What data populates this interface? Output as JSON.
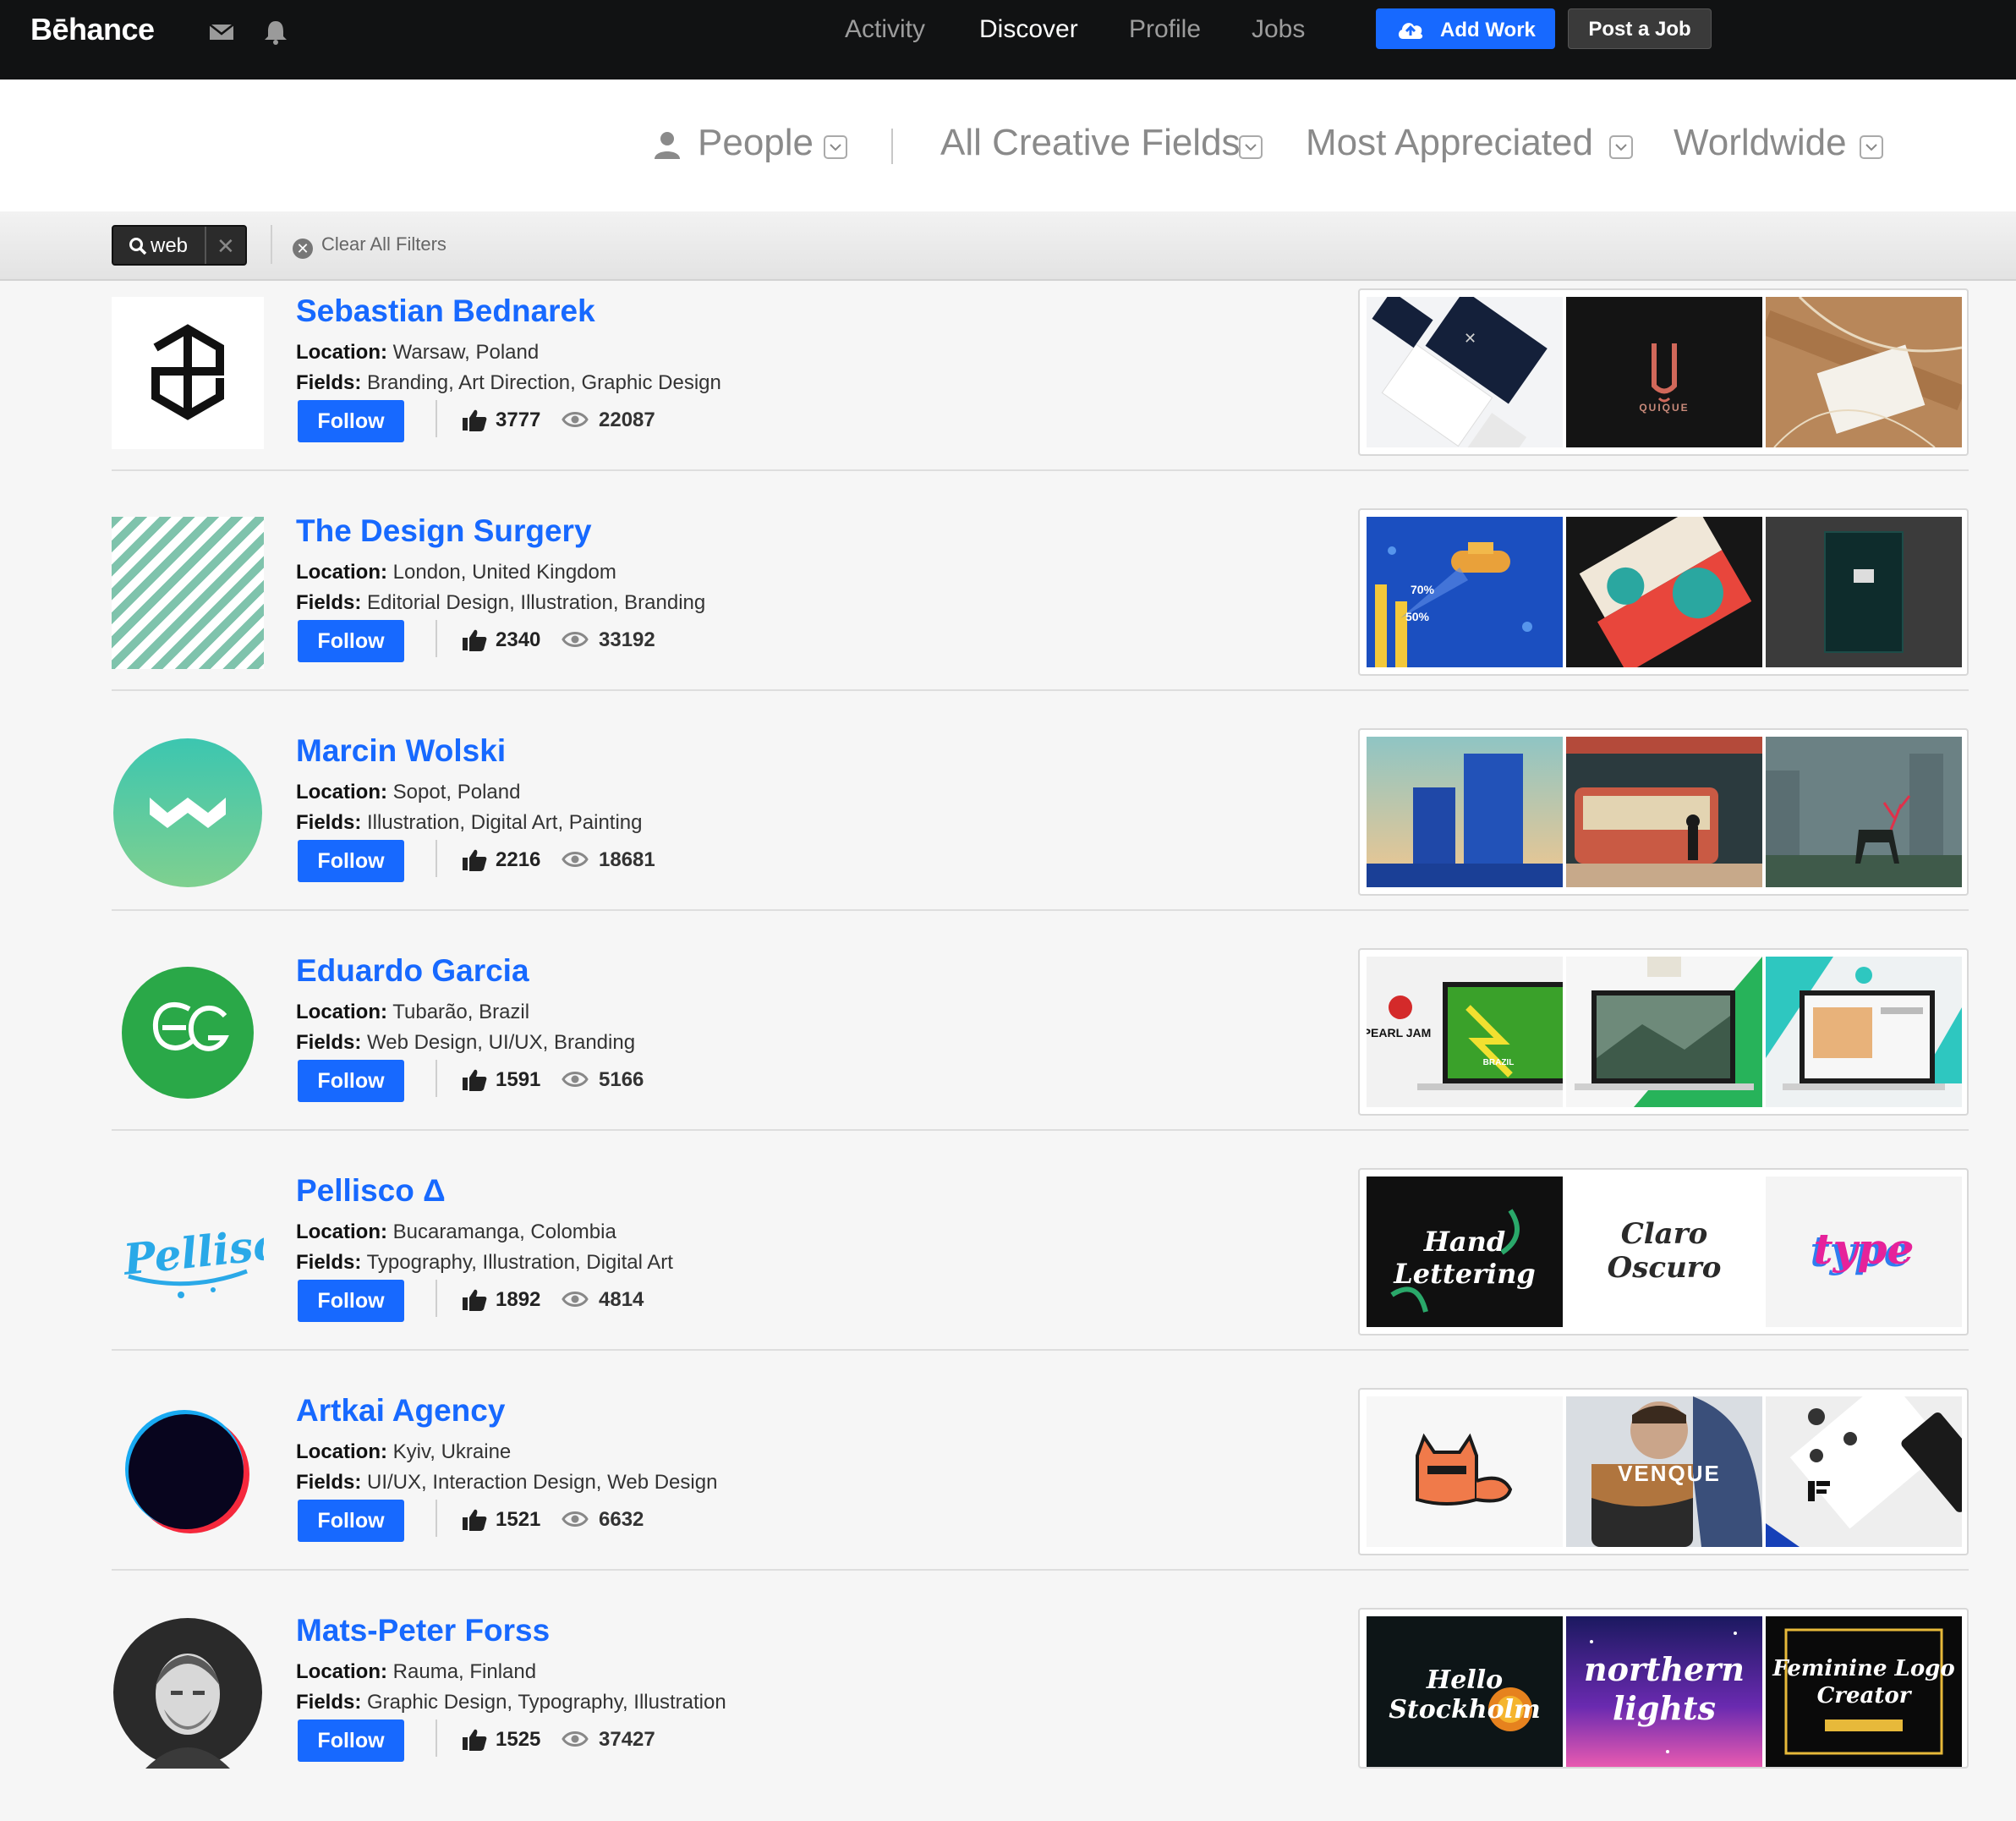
{
  "nav": {
    "logo": "Bēhance",
    "links": [
      "Activity",
      "Discover",
      "Profile",
      "Jobs"
    ],
    "active_link": "Discover",
    "add_work": "Add Work",
    "post_job": "Post a Job"
  },
  "filters": {
    "type": "People",
    "creative_fields": "All Creative Fields",
    "sort": "Most Appreciated",
    "location": "Worldwide"
  },
  "search": {
    "query": "web",
    "clear_all": "Clear All Filters"
  },
  "labels": {
    "location": "Location:",
    "fields": "Fields:",
    "follow": "Follow"
  },
  "colors": {
    "accent": "#1769ff",
    "topbar": "#111213"
  },
  "results": [
    {
      "name": "Sebastian Bednarek",
      "location": "Warsaw, Poland",
      "fields": "Branding, Art Direction, Graphic Design",
      "appreciations": "3777",
      "views": "22087"
    },
    {
      "name": "The Design Surgery",
      "location": "London, United Kingdom",
      "fields": "Editorial Design, Illustration, Branding",
      "appreciations": "2340",
      "views": "33192"
    },
    {
      "name": "Marcin Wolski",
      "location": "Sopot, Poland",
      "fields": "Illustration, Digital Art, Painting",
      "appreciations": "2216",
      "views": "18681"
    },
    {
      "name": "Eduardo Garcia",
      "location": "Tubarão, Brazil",
      "fields": "Web Design, UI/UX, Branding",
      "appreciations": "1591",
      "views": "5166"
    },
    {
      "name": "Pellisco Δ",
      "location": "Bucaramanga, Colombia",
      "fields": "Typography, Illustration, Digital Art",
      "appreciations": "1892",
      "views": "4814"
    },
    {
      "name": "Artkai Agency",
      "location": "Kyiv, Ukraine",
      "fields": "UI/UX, Interaction Design, Web Design",
      "appreciations": "1521",
      "views": "6632"
    },
    {
      "name": "Mats-Peter Forss",
      "location": "Rauma, Finland",
      "fields": "Graphic Design, Typography, Illustration",
      "appreciations": "1525",
      "views": "37427"
    }
  ],
  "thumbnail_text": {
    "r1t2": "QUIQUE",
    "r2t1a": "70%",
    "r2t1b": "50%",
    "r4t1": "PEARL JAM",
    "r4t1b": "BRAZIL",
    "r5t1": "Hand Lettering",
    "r5t2": "Claro Oscuro",
    "r5t3": "type",
    "r6t2": "VENQUE",
    "r7t1": "Hello Stockholm",
    "r7t2": "northern lights",
    "r7t3": "Feminine Logo Creator"
  }
}
